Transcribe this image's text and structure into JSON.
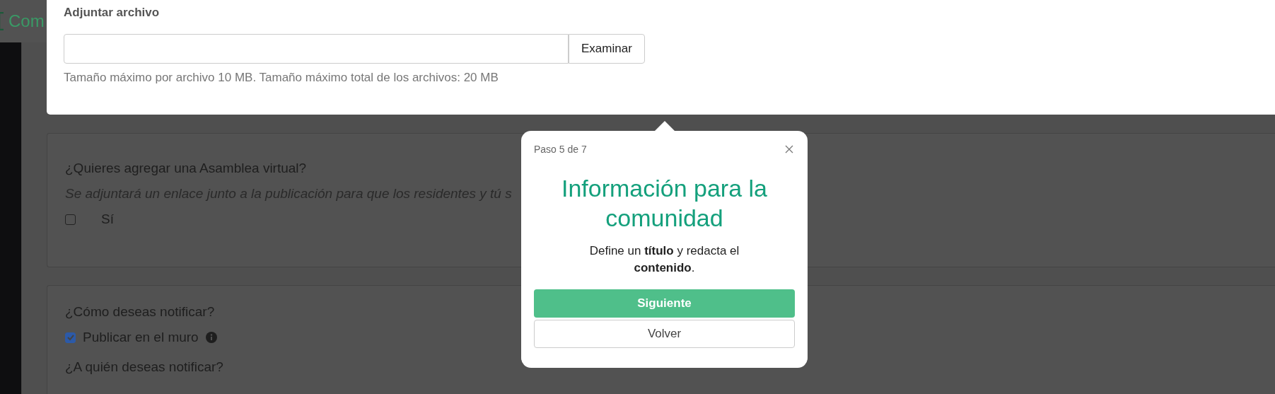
{
  "header": {
    "logo": "Com"
  },
  "attachment": {
    "title": "Adjuntar archivo",
    "browse_button": "Examinar",
    "hint": "Tamaño máximo por archivo 10 MB. Tamaño máximo total de los archivos: 20 MB"
  },
  "sections": [
    {
      "items": [
        {
          "kind": "question",
          "text": "¿Quieres agregar una Asamblea virtual?"
        },
        {
          "kind": "note",
          "text": "Se adjuntará un enlace junto a la publicación para que los residentes y tú s"
        },
        {
          "kind": "checkbox",
          "label": "Sí",
          "checked": false,
          "info": false
        }
      ]
    },
    {
      "items": [
        {
          "kind": "question",
          "text": "¿Cómo deseas notificar?"
        },
        {
          "kind": "checkbox",
          "label": "Publicar en el muro",
          "checked": true,
          "info": true
        },
        {
          "kind": "question",
          "text": "¿A quién deseas notificar?"
        }
      ]
    }
  ],
  "tour": {
    "step": "Paso 5 de 7",
    "title": "Información para la comunidad",
    "body": "Define un **título** y redacta el **contenido**.",
    "buttons": [
      {
        "label": "Siguiente",
        "kind": "primary"
      },
      {
        "label": "Volver",
        "kind": "secondary"
      }
    ]
  }
}
